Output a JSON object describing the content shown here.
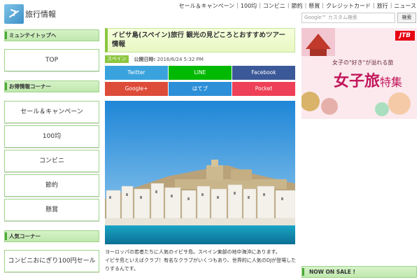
{
  "header": {
    "site_title": "旅行情報",
    "nav": [
      "セール＆キャンペーン",
      "100均",
      "コンビニ",
      "節約",
      "懸賞",
      "クレジットカード",
      "旅行",
      "ニュース"
    ]
  },
  "sidebar": {
    "sections": [
      {
        "title": "ミュンテイトップへ",
        "items": [
          "TOP"
        ]
      },
      {
        "title": "お得情報コーナー",
        "items": [
          "セール＆キャンペーン",
          "100均",
          "コンビニ",
          "節約",
          "懸賞"
        ]
      },
      {
        "title": "人気コーナー",
        "items": [
          "コンビニおにぎり100円セール"
        ]
      }
    ]
  },
  "article": {
    "title": "イビサ島(スペイン)旅行 観光の見どころとおすすめツアー情報",
    "category": "スペイン",
    "published_label": "公開日時:",
    "published": "2016/6/24 5:32 PM",
    "share": [
      {
        "label": "Twitter",
        "color": "#3aa3dd"
      },
      {
        "label": "LINE",
        "color": "#00b900"
      },
      {
        "label": "Facebook",
        "color": "#3b5998"
      },
      {
        "label": "Google+",
        "color": "#dd4b39"
      },
      {
        "label": "はてブ",
        "color": "#2c8fd8"
      },
      {
        "label": "Pocket",
        "color": "#ee4056"
      }
    ],
    "body": [
      "ヨーロッパの若者たちに人気のイビサ島。スペイン東部の地中海沖にあります。",
      "イビサ島といえばクラブ！有名なクラブがいくつもあり、世界的に人気のDJが登場したりするんです。"
    ]
  },
  "right": {
    "search_placeholder": "Google™ カスタム検索",
    "search_button": "検索",
    "ad": {
      "brand": "JTB",
      "tagline": "女子の\"好き\"が溢れる旅",
      "headline": "女子旅",
      "headline2": "特集"
    },
    "section_title": "NOW ON SALE !"
  }
}
